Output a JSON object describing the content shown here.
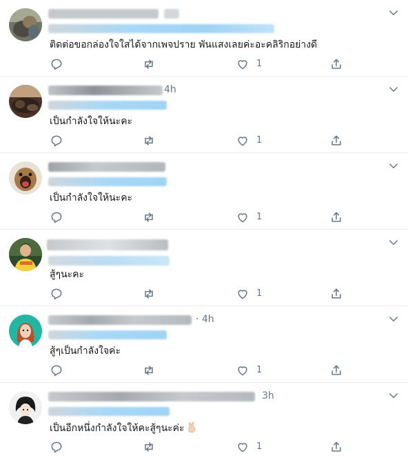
{
  "tweets": [
    {
      "time": "",
      "text": "ติดต่อขอกล่องใจใสได้จากเพจปราย พันแสงเลยค่ะอะคลิริกอย่างดี",
      "reply_count": "",
      "retweet_count": "",
      "like_count": "1"
    },
    {
      "time": "4h",
      "text": "เป็นกำลังใจให้นะคะ",
      "reply_count": "",
      "retweet_count": "",
      "like_count": "1"
    },
    {
      "time": "",
      "text": "เป็นกำลังใจให้นะคะ",
      "reply_count": "",
      "retweet_count": "",
      "like_count": "1"
    },
    {
      "time": "",
      "text": "สู้ๆนะคะ",
      "reply_count": "",
      "retweet_count": "",
      "like_count": "1"
    },
    {
      "time": "· 4h",
      "text": "สู้ๆเป็นกำลังใจค่ะ",
      "reply_count": "",
      "retweet_count": "",
      "like_count": "1"
    },
    {
      "time": "3h",
      "text": "เป็นอีกหนึ่งกำลังใจให้คะสู้ๆนะค่ะ",
      "reply_count": "",
      "retweet_count": "",
      "like_count": "1",
      "emoji": "victory-hand"
    }
  ],
  "colors": {
    "text": "#14171a",
    "secondary": "#657786",
    "divider": "#e6ecf0",
    "blur_gray": "#c6c9cc",
    "blur_blue": "#9fd3f5"
  },
  "icons": [
    "reply-icon",
    "retweet-icon",
    "like-icon",
    "share-icon",
    "chevron-down-icon"
  ]
}
